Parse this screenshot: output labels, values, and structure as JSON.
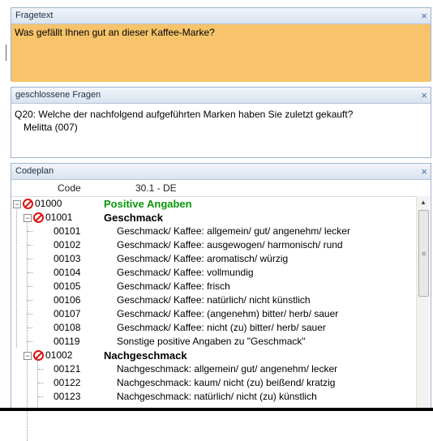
{
  "panels": {
    "fragetext": {
      "title": "Fragetext",
      "text": "Was gefällt Ihnen gut an dieser Kaffee-Marke?"
    },
    "geschlossene": {
      "title": "geschlossene Fragen",
      "line1": "Q20: Welche der nachfolgend aufgeführten Marken haben Sie zuletzt gekauft?",
      "line2": "Melitta (007)"
    },
    "codeplan": {
      "title": "Codeplan",
      "col_code": "Code",
      "col_lang": "30.1 - DE",
      "rows": [
        {
          "code": "01000",
          "label": "Positive Angaben"
        },
        {
          "code": "01001",
          "label": "Geschmack"
        },
        {
          "code": "00101",
          "label": "Geschmack/ Kaffee: allgemein/ gut/ angenehm/ lecker"
        },
        {
          "code": "00102",
          "label": "Geschmack/ Kaffee: ausgewogen/ harmonisch/ rund"
        },
        {
          "code": "00103",
          "label": "Geschmack/ Kaffee: aromatisch/ würzig"
        },
        {
          "code": "00104",
          "label": "Geschmack/ Kaffee: vollmundig"
        },
        {
          "code": "00105",
          "label": "Geschmack/ Kaffee: frisch"
        },
        {
          "code": "00106",
          "label": "Geschmack/ Kaffee: natürlich/ nicht künstlich"
        },
        {
          "code": "00107",
          "label": "Geschmack/ Kaffee: (angenehm) bitter/ herb/ sauer"
        },
        {
          "code": "00108",
          "label": "Geschmack/ Kaffee: nicht (zu) bitter/ herb/ sauer"
        },
        {
          "code": "00119",
          "label": "Sonstige positive Angaben zu \"Geschmack\""
        },
        {
          "code": "01002",
          "label": "Nachgeschmack"
        },
        {
          "code": "00121",
          "label": "Nachgeschmack: allgemein/ gut/ angenehm/ lecker"
        },
        {
          "code": "00122",
          "label": "Nachgeschmack: kaum/ nicht (zu) beißend/ kratzig"
        },
        {
          "code": "00123",
          "label": "Nachgeschmack: natürlich/ nicht (zu) künstlich"
        }
      ]
    }
  },
  "icons": {
    "close": "×",
    "expander": "−",
    "scroll_up": "▲",
    "grip": "≡"
  }
}
